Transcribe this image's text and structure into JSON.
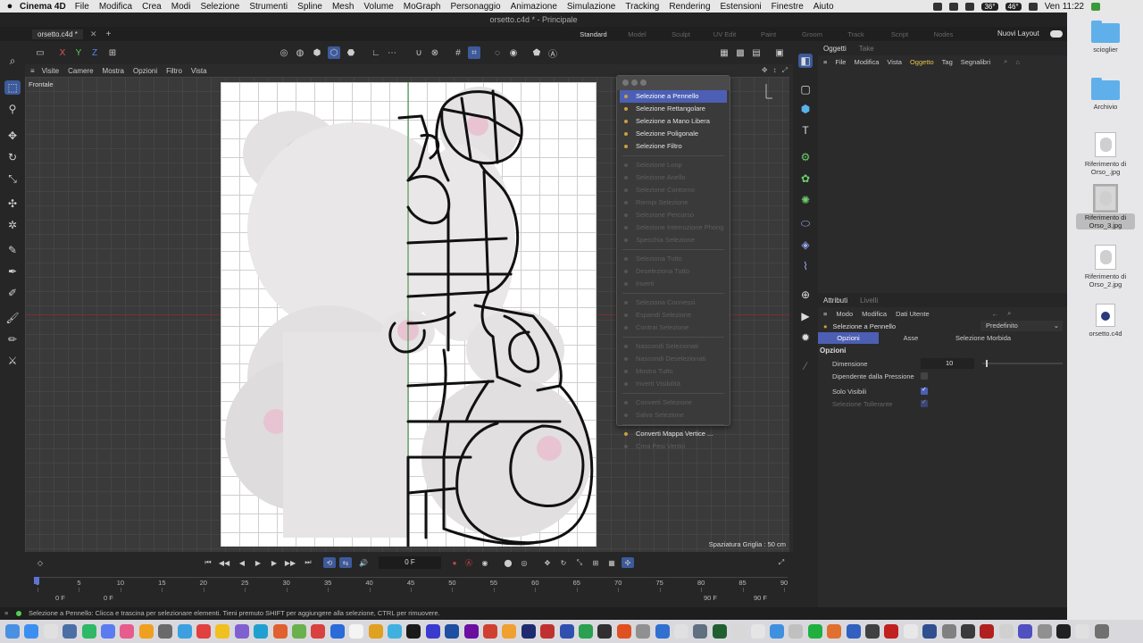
{
  "menubar": {
    "app": "Cinema 4D",
    "items": [
      "File",
      "Modifica",
      "Crea",
      "Modi",
      "Selezione",
      "Strumenti",
      "Spline",
      "Mesh",
      "Volume",
      "MoGraph",
      "Personaggio",
      "Animazione",
      "Simulazione",
      "Tracking",
      "Rendering",
      "Estensioni",
      "Finestre",
      "Aiuto"
    ],
    "badge1": "36°",
    "badge2": "46°",
    "clock": "Ven 11:22"
  },
  "window": {
    "title": "orsetto.c4d * - Principale",
    "doc_tab": "orsetto.c4d *",
    "layouts": [
      "Standard",
      "Model",
      "Sculpt",
      "UV Edit",
      "Paint",
      "Groom",
      "Track",
      "Script",
      "Nodes"
    ],
    "new_layout": "Nuovi Layout"
  },
  "viewport": {
    "menu": [
      "Visite",
      "Camere",
      "Mostra",
      "Opzioni",
      "Filtro",
      "Vista"
    ],
    "name": "Frontale",
    "grid_spacing": "Spaziatura Griglia : 50 cm"
  },
  "selection_menu": {
    "items": [
      {
        "label": "Selezione a Pennello",
        "state": "selected"
      },
      {
        "label": "Selezione Rettangolare",
        "state": "enabled"
      },
      {
        "label": "Selezione a Mano Libera",
        "state": "enabled"
      },
      {
        "label": "Selezione Poligonale",
        "state": "enabled"
      },
      {
        "label": "Selezione Filtro",
        "state": "enabled"
      },
      {
        "label": "Selezione Loop",
        "state": "disabled"
      },
      {
        "label": "Selezione Anello",
        "state": "disabled"
      },
      {
        "label": "Selezione Contorno",
        "state": "disabled"
      },
      {
        "label": "Riempi Selezione",
        "state": "disabled"
      },
      {
        "label": "Selezione Percorso",
        "state": "disabled"
      },
      {
        "label": "Selezione Interruzione Phong",
        "state": "disabled"
      },
      {
        "label": "Specchia Selezione",
        "state": "disabled"
      },
      {
        "label": "Seleziona Tutto",
        "state": "disabled"
      },
      {
        "label": "Deseleziona Tutto",
        "state": "disabled"
      },
      {
        "label": "Inverti",
        "state": "disabled"
      },
      {
        "label": "Seleziona Connessi",
        "state": "disabled"
      },
      {
        "label": "Espandi Selezione",
        "state": "disabled"
      },
      {
        "label": "Contrai Selezione",
        "state": "disabled"
      },
      {
        "label": "Nascondi Selezionati",
        "state": "disabled"
      },
      {
        "label": "Nascondi Deselezionati",
        "state": "disabled"
      },
      {
        "label": "Mostra Tutto",
        "state": "disabled"
      },
      {
        "label": "Inverti Visibilità",
        "state": "disabled"
      },
      {
        "label": "Converti Selezione",
        "state": "disabled"
      },
      {
        "label": "Salva Selezione",
        "state": "disabled"
      },
      {
        "label": "Converti Mappa Vertice ...",
        "state": "enabled"
      },
      {
        "label": "Crea Pesi Vertici",
        "state": "disabled"
      }
    ]
  },
  "objects_panel": {
    "tabs": [
      "Oggetti",
      "Take"
    ],
    "menu": [
      "File",
      "Modifica",
      "Vista",
      "Oggetto",
      "Tag",
      "Segnalibri"
    ]
  },
  "attributes_panel": {
    "tabs": [
      "Attributi",
      "Livelli"
    ],
    "menu": [
      "Modo",
      "Modifica",
      "Dati Utente"
    ],
    "object": "Selezione a Pennello",
    "preset": "Predefinito",
    "subtabs": [
      "Opzioni",
      "Asse",
      "Selezione Morbida"
    ],
    "section": "Opzioni",
    "rows": [
      {
        "label": "Dimensione",
        "value": "10"
      },
      {
        "label": "Dipendente dalla Pressione"
      },
      {
        "label": "Solo Visibili"
      },
      {
        "label": "Selezione Tollerante"
      }
    ]
  },
  "timeline": {
    "frame": "0 F",
    "ticks": [
      "0",
      "5",
      "10",
      "15",
      "20",
      "25",
      "30",
      "35",
      "40",
      "45",
      "50",
      "55",
      "60",
      "65",
      "70",
      "75",
      "80",
      "85",
      "90"
    ],
    "range_start_a": "0 F",
    "range_start_b": "0 F",
    "range_end_a": "90 F",
    "range_end_b": "90 F"
  },
  "status": "Selezione a Pennello: Clicca e trascina per selezionare elementi. Tieni premuto SHIFT per aggiungere alla selezione, CTRL per rimuovere.",
  "desktop": [
    {
      "caption": "scioglier"
    },
    {
      "caption": "Archivio"
    },
    {
      "caption": "Riferimento di Orso_.jpg"
    },
    {
      "caption": "Riferimento di Orso_3.jpg"
    },
    {
      "caption": "Riferimento di Orso_2.jpg"
    },
    {
      "caption": "orsetto.c4d"
    }
  ]
}
